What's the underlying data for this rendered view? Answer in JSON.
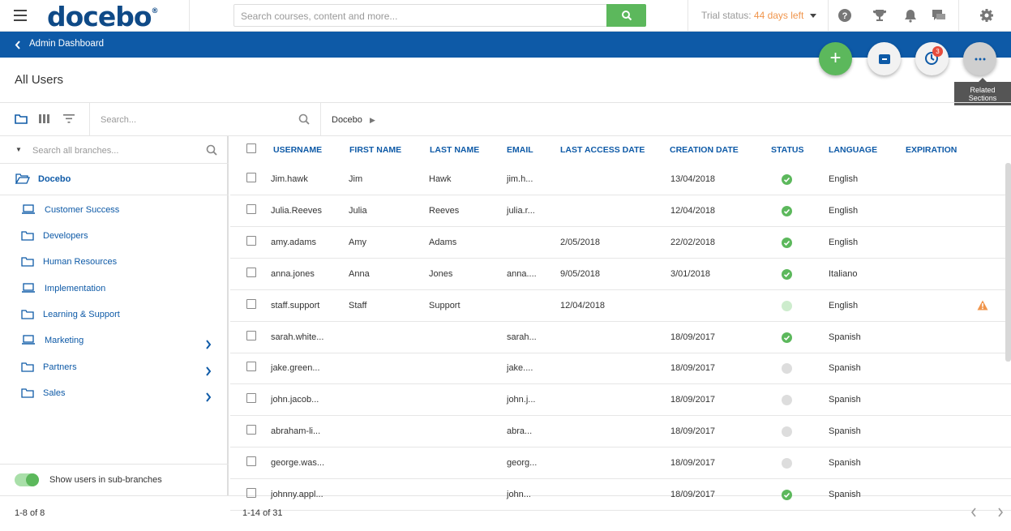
{
  "app": {
    "logo": "docebo"
  },
  "topbar": {
    "search_placeholder": "Search courses, content and more...",
    "trial_label": "Trial status: ",
    "trial_days": "44 days left"
  },
  "nav": {
    "back_label": "Admin Dashboard"
  },
  "page": {
    "title": "All Users"
  },
  "fabs": {
    "badge_count": "3",
    "tooltip_line1": "Related",
    "tooltip_line2": "Sections"
  },
  "toolbar": {
    "search_placeholder": "Search...",
    "breadcrumb": "Docebo"
  },
  "sidebar": {
    "search_placeholder": "Search all branches...",
    "root": "Docebo",
    "items": [
      {
        "label": "Customer Success",
        "icon": "laptop-icon",
        "has_children": false
      },
      {
        "label": "Developers",
        "icon": "folder-icon",
        "has_children": false
      },
      {
        "label": "Human Resources",
        "icon": "folder-icon",
        "has_children": false
      },
      {
        "label": "Implementation",
        "icon": "laptop-icon",
        "has_children": false
      },
      {
        "label": "Learning & Support",
        "icon": "folder-icon",
        "has_children": false
      },
      {
        "label": "Marketing",
        "icon": "laptop-icon",
        "has_children": true
      },
      {
        "label": "Partners",
        "icon": "folder-icon",
        "has_children": true
      },
      {
        "label": "Sales",
        "icon": "folder-icon",
        "has_children": true
      }
    ],
    "toggle_label": "Show users in sub-branches",
    "footer": "1-8 of 8"
  },
  "table": {
    "columns": [
      "USERNAME",
      "FIRST NAME",
      "LAST NAME",
      "EMAIL",
      "LAST ACCESS DATE",
      "CREATION DATE",
      "STATUS",
      "LANGUAGE",
      "EXPIRATION"
    ],
    "rows": [
      {
        "username": "Jim.hawk",
        "first": "Jim",
        "last": "Hawk",
        "email": "jim.h...",
        "last_access": "",
        "created": "13/04/2018",
        "status": "active",
        "language": "English",
        "warning": false
      },
      {
        "username": "Julia.Reeves",
        "first": "Julia",
        "last": "Reeves",
        "email": "julia.r...",
        "last_access": "",
        "created": "12/04/2018",
        "status": "active",
        "language": "English",
        "warning": false
      },
      {
        "username": "amy.adams",
        "first": "Amy",
        "last": "Adams",
        "email": "",
        "last_access": "2/05/2018",
        "created": "22/02/2018",
        "status": "active",
        "language": "English",
        "warning": false
      },
      {
        "username": "anna.jones",
        "first": "Anna",
        "last": "Jones",
        "email": "anna....",
        "last_access": "9/05/2018",
        "created": "3/01/2018",
        "status": "active",
        "language": "Italiano",
        "warning": false
      },
      {
        "username": "staff.support",
        "first": "Staff",
        "last": "Support",
        "email": "",
        "last_access": "12/04/2018",
        "created": "",
        "status": "pending",
        "language": "English",
        "warning": true
      },
      {
        "username": "sarah.white...",
        "first": "",
        "last": "",
        "email": "sarah...",
        "last_access": "",
        "created": "18/09/2017",
        "status": "active",
        "language": "Spanish",
        "warning": false
      },
      {
        "username": "jake.green...",
        "first": "",
        "last": "",
        "email": "jake....",
        "last_access": "",
        "created": "18/09/2017",
        "status": "inactive",
        "language": "Spanish",
        "warning": false
      },
      {
        "username": "john.jacob...",
        "first": "",
        "last": "",
        "email": "john.j...",
        "last_access": "",
        "created": "18/09/2017",
        "status": "inactive",
        "language": "Spanish",
        "warning": false
      },
      {
        "username": "abraham-li...",
        "first": "",
        "last": "",
        "email": "abra...",
        "last_access": "",
        "created": "18/09/2017",
        "status": "inactive",
        "language": "Spanish",
        "warning": false
      },
      {
        "username": "george.was...",
        "first": "",
        "last": "",
        "email": "georg...",
        "last_access": "",
        "created": "18/09/2017",
        "status": "inactive",
        "language": "Spanish",
        "warning": false
      },
      {
        "username": "johnny.appl...",
        "first": "",
        "last": "",
        "email": "john...",
        "last_access": "",
        "created": "18/09/2017",
        "status": "active",
        "language": "Spanish",
        "warning": false
      }
    ],
    "footer": "1-14 of 31"
  },
  "colors": {
    "brand": "#0e5aa7",
    "accent_green": "#5cb85c",
    "status_active": "#5cb85c",
    "status_pending": "#cdeccd",
    "status_inactive": "#dddddd",
    "warning": "#f0954c"
  }
}
